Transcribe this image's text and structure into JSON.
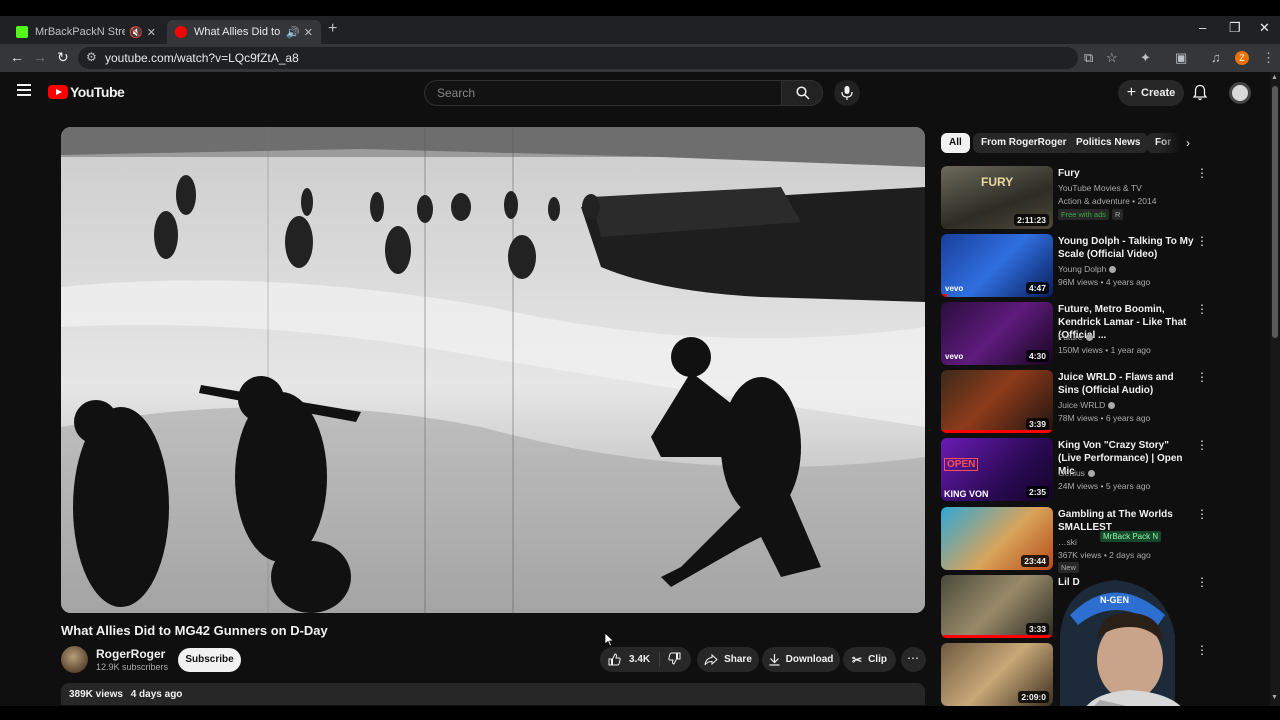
{
  "browser": {
    "tabs": [
      {
        "title": "MrBackPackN Stream - Watch",
        "favicon_color": "#53fc18",
        "icons": [
          "muted-speaker-icon",
          "close-icon"
        ]
      },
      {
        "title": "What Allies Did to MG42 Gunners",
        "favicon_color": "#ff0000",
        "icons": [
          "speaker-icon",
          "close-icon"
        ],
        "active": true
      }
    ],
    "url": "youtube.com/watch?v=LQc9fZtA_a8",
    "profile_initial": "Z"
  },
  "youtube": {
    "logo_text": "YouTube",
    "search_placeholder": "Search",
    "create_label": "Create"
  },
  "video": {
    "title": "What Allies Did to MG42 Gunners on D-Day",
    "channel": "RogerRoger",
    "subscribers": "12.9K subscribers",
    "subscribe_label": "Subscribe",
    "likes": "3.4K",
    "share_label": "Share",
    "download_label": "Download",
    "clip_label": "Clip",
    "views": "389K views",
    "posted": "4 days ago"
  },
  "chips": [
    "All",
    "From RogerRoger",
    "Politics News",
    "For"
  ],
  "recommendations": [
    {
      "title": "Fury",
      "channel": "YouTube Movies & TV",
      "meta": "Action & adventure • 2014",
      "badges": [
        "Free with ads",
        "R"
      ],
      "duration": "2:11:23",
      "verified": false
    },
    {
      "title": "Young Dolph - Talking To My Scale (Official Video)",
      "channel": "Young Dolph",
      "meta": "96M views • 4 years ago",
      "duration": "4:47",
      "verified": true
    },
    {
      "title": "Future, Metro Boomin, Kendrick Lamar - Like That (Official ...",
      "channel": "Future",
      "meta": "150M views • 1 year ago",
      "duration": "4:30",
      "verified": true
    },
    {
      "title": "Juice WRLD - Flaws and Sins (Official Audio)",
      "channel": "Juice WRLD",
      "meta": "78M views • 6 years ago",
      "duration": "3:39",
      "verified": true
    },
    {
      "title": "King Von \"Crazy Story\" (Live Performance) | Open Mic",
      "channel": "Genius",
      "meta": "24M views • 5 years ago",
      "duration": "2:35",
      "verified": true
    },
    {
      "title": "Gambling at The Worlds SMALLEST",
      "channel": "…ski",
      "meta": "367K views • 2 days ago",
      "duration": "23:44",
      "badge_new": "New"
    },
    {
      "title": "Lil D",
      "channel": "",
      "meta": "",
      "duration": "3:33"
    },
    {
      "title": "",
      "channel": "",
      "meta": "",
      "duration": "2:09:0"
    }
  ],
  "thumb_labels": {
    "fury": "FURY",
    "vevo": "vevo",
    "kingvon": "KING VON",
    "open": "OPEN"
  },
  "overlay": {
    "stream_tag": "MrBack Pack N",
    "chair_brand": "N-GEN"
  },
  "colors": {
    "accent": "#ff0000",
    "background": "#0f0f0f",
    "chip_active": "#f1f1f1"
  }
}
